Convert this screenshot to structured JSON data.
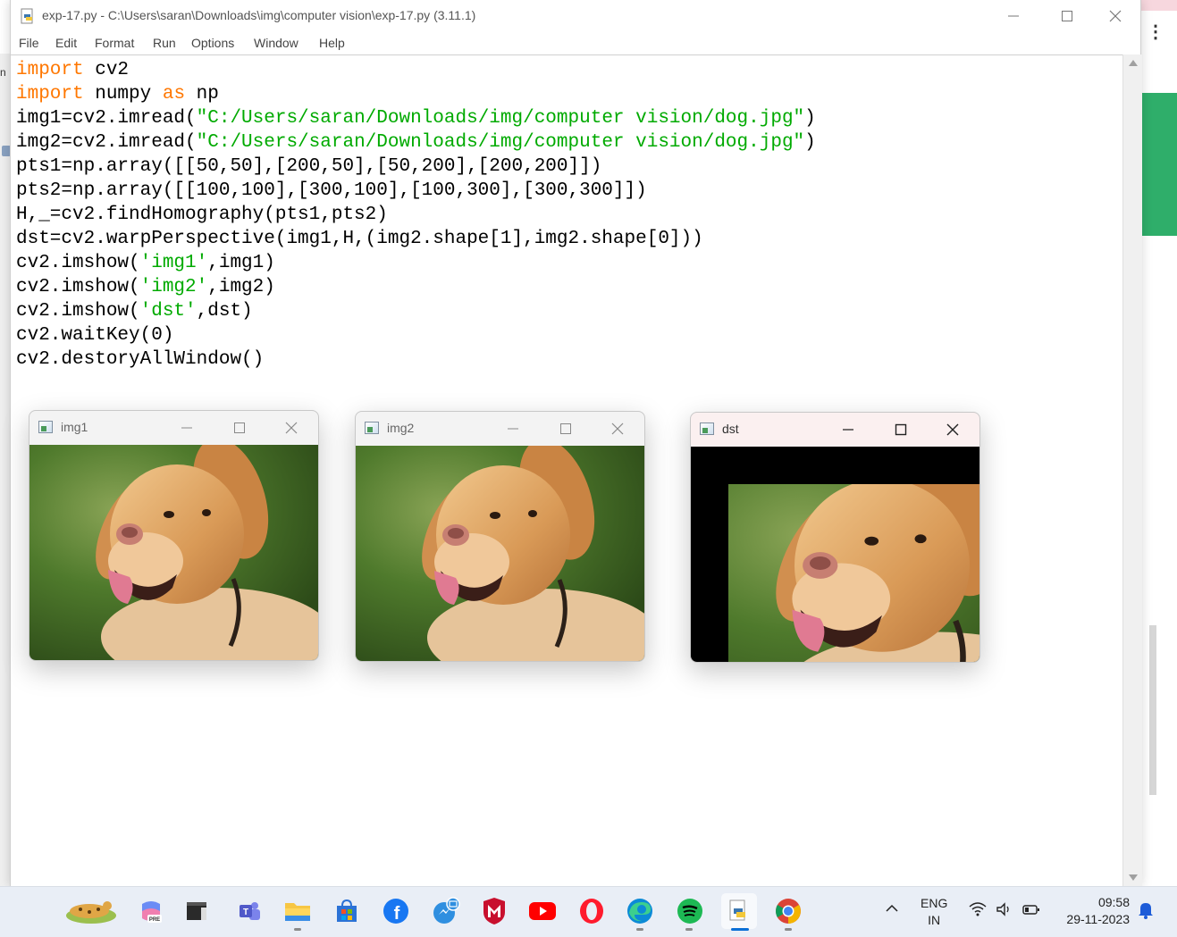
{
  "window": {
    "title": "exp-17.py - C:\\Users\\saran\\Downloads\\img\\computer vision\\exp-17.py (3.11.1)"
  },
  "menu": [
    "File",
    "Edit",
    "Format",
    "Run",
    "Options",
    "Window",
    "Help"
  ],
  "background_peek": {
    "left_text": "n"
  },
  "code_lines": [
    [
      {
        "t": "import",
        "c": "kw"
      },
      {
        "t": " cv2",
        "c": ""
      }
    ],
    [
      {
        "t": "import",
        "c": "kw"
      },
      {
        "t": " numpy ",
        "c": ""
      },
      {
        "t": "as",
        "c": "kw"
      },
      {
        "t": " np",
        "c": ""
      }
    ],
    [
      {
        "t": "img1=cv2.imread(",
        "c": ""
      },
      {
        "t": "\"C:/Users/saran/Downloads/img/computer vision/dog.jpg\"",
        "c": "str"
      },
      {
        "t": ")",
        "c": ""
      }
    ],
    [
      {
        "t": "img2=cv2.imread(",
        "c": ""
      },
      {
        "t": "\"C:/Users/saran/Downloads/img/computer vision/dog.jpg\"",
        "c": "str"
      },
      {
        "t": ")",
        "c": ""
      }
    ],
    [
      {
        "t": "pts1=np.array([[50,50],[200,50],[50,200],[200,200]])",
        "c": ""
      }
    ],
    [
      {
        "t": "pts2=np.array([[100,100],[300,100],[100,300],[300,300]])",
        "c": ""
      }
    ],
    [
      {
        "t": "H,_=cv2.findHomography(pts1,pts2)",
        "c": ""
      }
    ],
    [
      {
        "t": "dst=cv2.warpPerspective(img1,H,(img2.shape[1],img2.shape[0]))",
        "c": ""
      }
    ],
    [
      {
        "t": "cv2.imshow(",
        "c": ""
      },
      {
        "t": "'img1'",
        "c": "str"
      },
      {
        "t": ",img1)",
        "c": ""
      }
    ],
    [
      {
        "t": "cv2.imshow(",
        "c": ""
      },
      {
        "t": "'img2'",
        "c": "str"
      },
      {
        "t": ",img2)",
        "c": ""
      }
    ],
    [
      {
        "t": "cv2.imshow(",
        "c": ""
      },
      {
        "t": "'dst'",
        "c": "str"
      },
      {
        "t": ",dst)",
        "c": ""
      }
    ],
    [
      {
        "t": "cv2.waitKey(0)",
        "c": ""
      }
    ],
    [
      {
        "t": "cv2.destoryAllWindow()",
        "c": ""
      }
    ]
  ],
  "image_windows": {
    "img1": {
      "title": "img1"
    },
    "img2": {
      "title": "img2"
    },
    "dst": {
      "title": "dst"
    }
  },
  "taskbar": {
    "apps": [
      "leopard-widget",
      "copilot-pre",
      "cmd-terminal",
      "teams",
      "file-explorer",
      "microsoft-store",
      "facebook",
      "messenger",
      "mcafee",
      "youtube",
      "opera",
      "edge",
      "spotify",
      "python-idle",
      "chrome"
    ],
    "language": {
      "line1": "ENG",
      "line2": "IN"
    },
    "clock": {
      "time": "09:58",
      "date": "29-11-2023"
    }
  }
}
